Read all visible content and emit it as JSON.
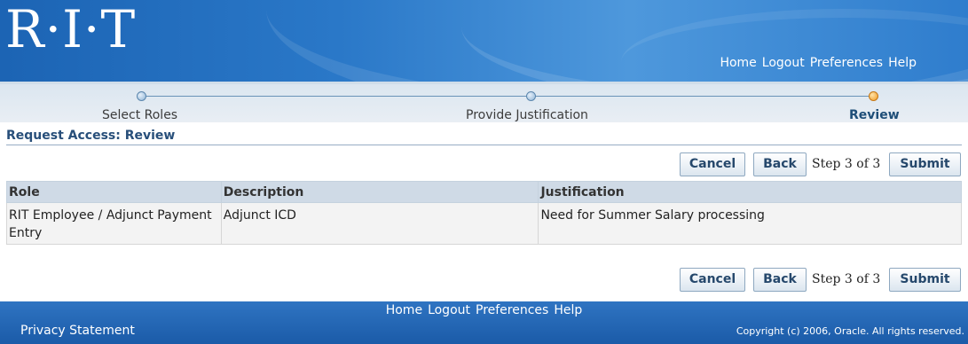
{
  "header": {
    "logo": "R·I·T",
    "nav": [
      "Home",
      "Logout",
      "Preferences",
      "Help"
    ]
  },
  "train": {
    "steps": [
      "Select Roles",
      "Provide Justification",
      "Review"
    ],
    "current_step": "Review"
  },
  "page": {
    "title": "Request Access: Review"
  },
  "actions": {
    "cancel_label": "Cancel",
    "back_label": "Back",
    "step_text": "Step 3 of 3",
    "submit_label": "Submit"
  },
  "table": {
    "headers": [
      "Role",
      "Description",
      "Justification"
    ],
    "rows": [
      [
        "RIT Employee / Adjunct Payment Entry",
        "Adjunct ICD",
        "Need for Summer Salary processing"
      ]
    ]
  },
  "footer": {
    "nav": [
      "Home",
      "Logout",
      "Preferences",
      "Help"
    ],
    "privacy": "Privacy Statement",
    "copyright": "Copyright (c) 2006, Oracle. All rights reserved."
  },
  "colors": {
    "header_blue": "#2a78c8",
    "train_current": "#f09a22",
    "title_blue": "#284f7a",
    "table_header": "#cfdae6"
  }
}
